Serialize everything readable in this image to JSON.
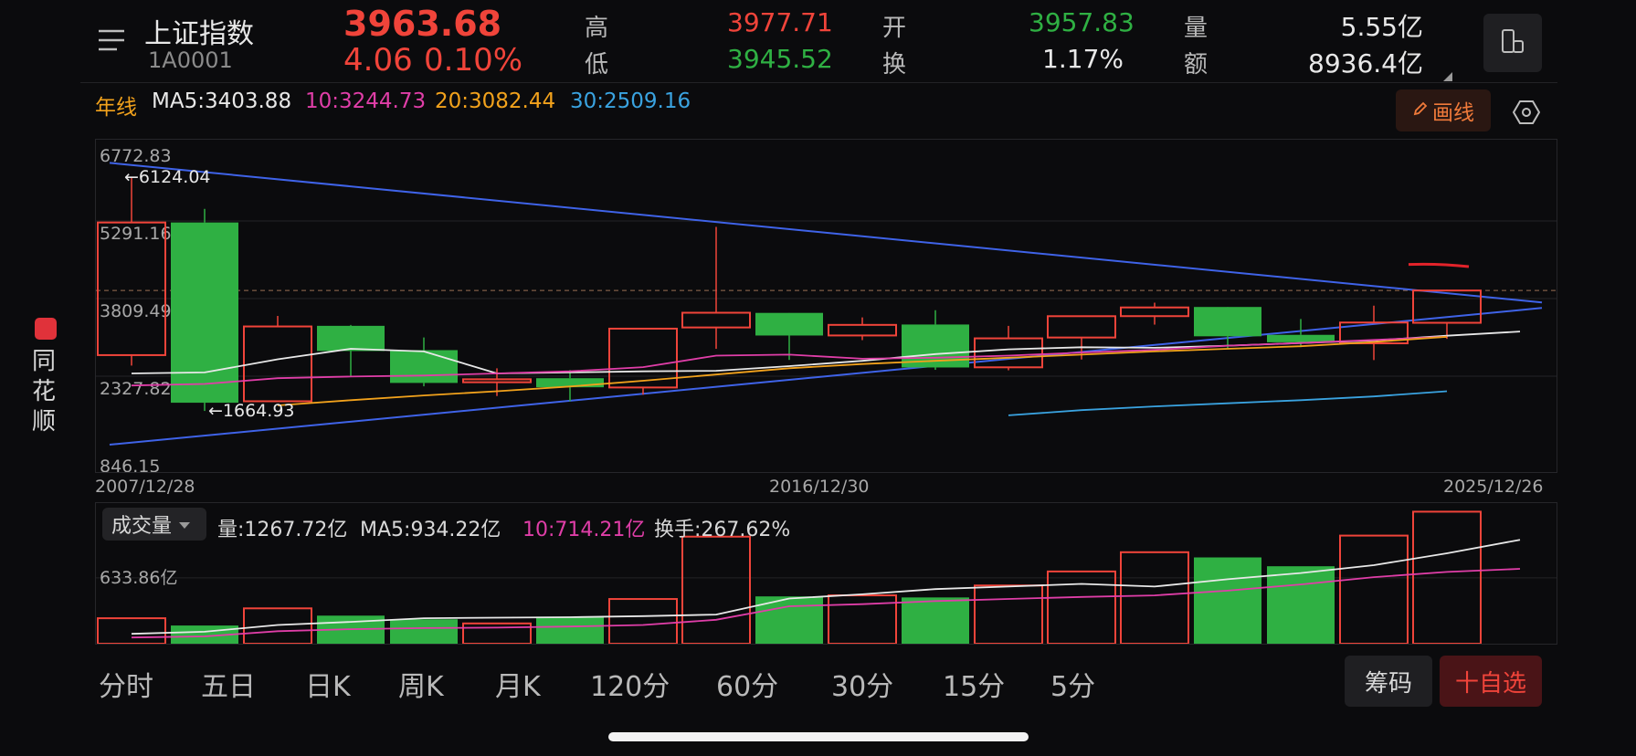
{
  "header": {
    "name": "上证指数",
    "code": "1A0001",
    "price": "3963.68",
    "change": "4.06",
    "change_pct": "0.10%",
    "high_label": "高",
    "high": "3977.71",
    "low_label": "低",
    "low": "3945.52",
    "open_label": "开",
    "open": "3957.83",
    "turnover_label": "换",
    "turnover": "1.17%",
    "volume_label": "量",
    "volume": "5.55亿",
    "amount_label": "额",
    "amount": "8936.4亿"
  },
  "ma_bar": {
    "period": "年线",
    "ma5": "MA5:3403.88",
    "ma10": "10:3244.73",
    "ma20": "20:3082.44",
    "ma30": "30:2509.16",
    "draw_label": "画线"
  },
  "side_logo": "同花顺",
  "colors": {
    "up": "#f0443a",
    "down": "#2fb043",
    "ma5": "#e8e8e8",
    "ma10": "#e03ea8",
    "ma20": "#f2a21c",
    "ma30": "#3aa3e0",
    "trendline": "#3f63e8",
    "period": "#f2a21c"
  },
  "chart_data": {
    "type": "candlestick",
    "y_labels": [
      "6772.83",
      "5291.16",
      "3809.49",
      "2327.82",
      "846.15"
    ],
    "ylim": [
      846.15,
      6772.83
    ],
    "max_marker": "←6124.04",
    "min_marker": "←1664.93",
    "reference_price": 3963.68,
    "x_labels": [
      "2007/12/28",
      "2016/12/30",
      "2025/12/26"
    ],
    "candles": [
      {
        "year": 2007,
        "o": 2730,
        "c": 5262,
        "h": 6124,
        "l": 2530
      },
      {
        "year": 2008,
        "o": 5262,
        "c": 1821,
        "h": 5522,
        "l": 1664
      },
      {
        "year": 2009,
        "o": 1849,
        "c": 3277,
        "h": 3478,
        "l": 1844
      },
      {
        "year": 2010,
        "o": 3289,
        "c": 2808,
        "h": 3306,
        "l": 2319
      },
      {
        "year": 2011,
        "o": 2825,
        "c": 2199,
        "h": 3067,
        "l": 2134
      },
      {
        "year": 2012,
        "o": 2212,
        "c": 2269,
        "h": 2478,
        "l": 1949
      },
      {
        "year": 2013,
        "o": 2289,
        "c": 2116,
        "h": 2444,
        "l": 1849
      },
      {
        "year": 2014,
        "o": 2112,
        "c": 3235,
        "h": 3239,
        "l": 1974
      },
      {
        "year": 2015,
        "o": 3258,
        "c": 3539,
        "h": 5178,
        "l": 2850
      },
      {
        "year": 2016,
        "o": 3536,
        "c": 3104,
        "h": 3538,
        "l": 2638
      },
      {
        "year": 2017,
        "o": 3105,
        "c": 3307,
        "h": 3450,
        "l": 3016
      },
      {
        "year": 2018,
        "o": 3314,
        "c": 2494,
        "h": 3587,
        "l": 2449
      },
      {
        "year": 2019,
        "o": 2497,
        "c": 3050,
        "h": 3288,
        "l": 2440
      },
      {
        "year": 2020,
        "o": 3066,
        "c": 3473,
        "h": 3474,
        "l": 2646
      },
      {
        "year": 2021,
        "o": 3474,
        "c": 3640,
        "h": 3731,
        "l": 3312
      },
      {
        "year": 2022,
        "o": 3649,
        "c": 3089,
        "h": 3652,
        "l": 2863
      },
      {
        "year": 2023,
        "o": 3117,
        "c": 2975,
        "h": 3419,
        "l": 2882
      },
      {
        "year": 2024,
        "o": 2955,
        "c": 3352,
        "h": 3674,
        "l": 2635
      },
      {
        "year": 2025,
        "o": 3347,
        "c": 3963,
        "h": 3977,
        "l": 3040
      }
    ],
    "ma": {
      "ma5": {
        "start": 2007,
        "values": [
          2380,
          2400,
          2650,
          2850,
          2800,
          2380,
          2400,
          2420,
          2430,
          2520,
          2620,
          2750,
          2840,
          2880,
          2870,
          2910,
          2960,
          3010,
          3100,
          3180
        ]
      },
      "ma10": {
        "start": 2007,
        "values": [
          2150,
          2180,
          2290,
          2320,
          2340,
          2380,
          2420,
          2500,
          2720,
          2740,
          2660,
          2680,
          2720,
          2780,
          2830,
          2910,
          2960,
          3020,
          3080
        ]
      },
      "ma20": {
        "start": 2009,
        "values": [
          1770,
          1870,
          1960,
          2040,
          2130,
          2240,
          2360,
          2480,
          2560,
          2620,
          2680,
          2740,
          2800,
          2850,
          2900,
          2980,
          3080
        ]
      },
      "ma30": {
        "start": 2019,
        "values": [
          1580,
          1680,
          1750,
          1810,
          1870,
          1940,
          2040
        ]
      }
    },
    "trendlines": [
      {
        "x1": 2006.7,
        "y1": 6400,
        "x2": 2026.3,
        "y2": 3735
      },
      {
        "x1": 2006.7,
        "y1": 1020,
        "x2": 2026.3,
        "y2": 3630
      }
    ]
  },
  "volume": {
    "selector": "成交量",
    "amount": "量:1267.72亿",
    "ma5": "MA5:934.22亿",
    "ma10": "10:714.21亿",
    "turnover": "换手:267.62%",
    "y_label": "633.86亿",
    "ylim": [
      0,
      1300
    ],
    "bars": [
      245,
      175,
      340,
      270,
      235,
      195,
      260,
      430,
      1030,
      455,
      465,
      445,
      560,
      695,
      880,
      830,
      745,
      1040,
      1270
    ],
    "ma5_line": [
      95,
      115,
      180,
      210,
      245,
      250,
      255,
      265,
      280,
      435,
      475,
      525,
      550,
      575,
      550,
      620,
      680,
      755,
      870,
      1000
    ],
    "ma10_line": [
      60,
      70,
      120,
      140,
      150,
      155,
      165,
      180,
      230,
      360,
      380,
      410,
      430,
      450,
      465,
      510,
      570,
      640,
      690,
      720
    ]
  },
  "periods": [
    "分时",
    "五日",
    "日K",
    "周K",
    "月K",
    "120分",
    "60分",
    "30分",
    "15分",
    "5分"
  ],
  "chips_label": "筹码",
  "watchlist_label": "十自选"
}
